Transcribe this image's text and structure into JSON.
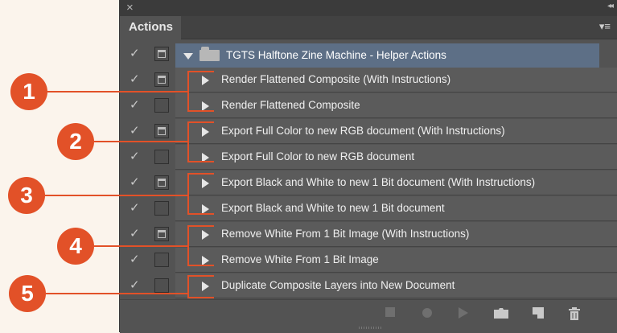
{
  "panel": {
    "close_glyph": "×",
    "collapse_glyph": "◂◂",
    "tab_label": "Actions",
    "menu_glyph": "▾≡"
  },
  "set": {
    "label": "TGTS  Halftone Zine Machine - Helper Actions"
  },
  "actions": [
    {
      "label": "Render Flattened Composite (With Instructions)",
      "dialog": true
    },
    {
      "label": "Render Flattened Composite",
      "dialog": false
    },
    {
      "label": "Export Full Color to new RGB document (With Instructions)",
      "dialog": true
    },
    {
      "label": "Export Full Color to new RGB document",
      "dialog": false
    },
    {
      "label": "Export Black and White to new 1 Bit document (With Instructions)",
      "dialog": true
    },
    {
      "label": "Export Black and White to new 1 Bit document",
      "dialog": false
    },
    {
      "label": "Remove White From 1 Bit Image (With Instructions)",
      "dialog": true
    },
    {
      "label": "Remove White From 1 Bit Image",
      "dialog": false
    },
    {
      "label": "Duplicate Composite Layers into New Document",
      "dialog": false
    }
  ],
  "callouts": [
    "1",
    "2",
    "3",
    "4",
    "5"
  ],
  "colors": {
    "accent": "#e25128",
    "selected_row": "#5d6f86",
    "panel_bg": "#535353"
  }
}
